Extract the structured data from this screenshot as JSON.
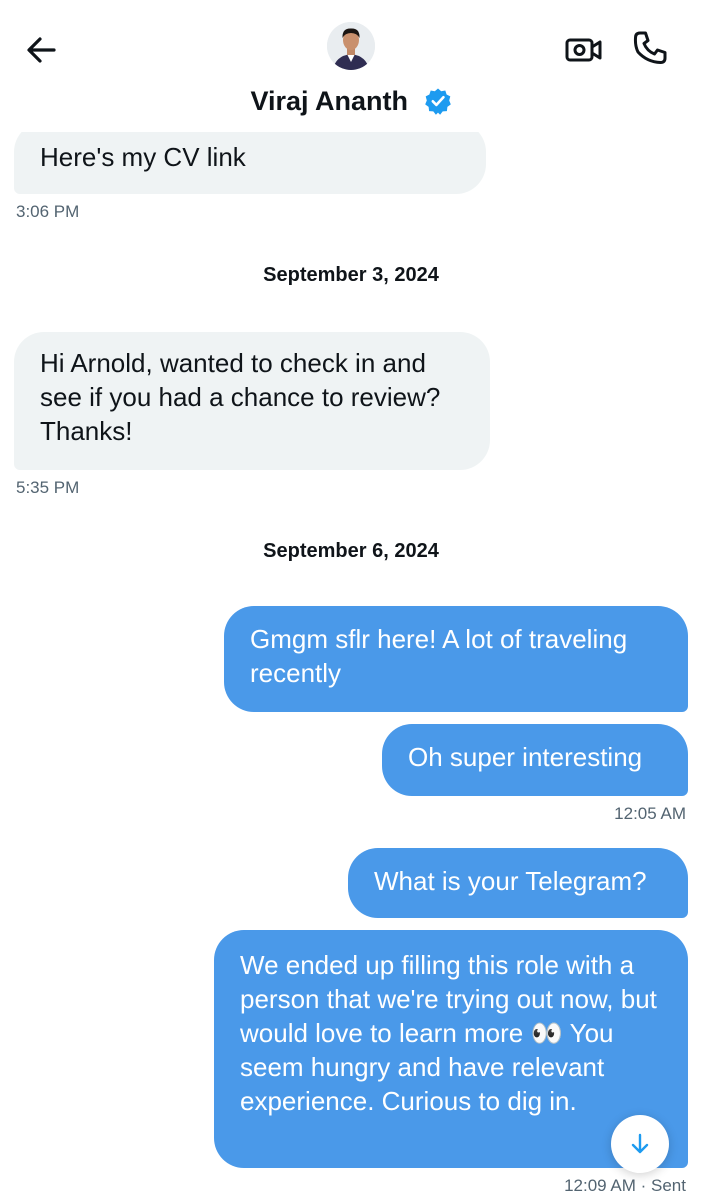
{
  "header": {
    "contact_name": "Viraj Ananth",
    "icons": {
      "back": "arrow-left-icon",
      "verified": "verified-badge-icon",
      "video": "video-call-icon",
      "phone": "phone-call-icon",
      "avatar": "avatar"
    }
  },
  "colors": {
    "outgoing_bubble": "#4a99e9",
    "incoming_bubble": "#eff3f4",
    "verified": "#1d9bf0",
    "timestamp": "#536471"
  },
  "messages": [
    {
      "text": "Here's my CV link",
      "time": "3:06 PM"
    },
    {
      "date_separator": "September 3, 2024"
    },
    {
      "text": "Hi Arnold, wanted to check in and see if you had a chance to review? Thanks!",
      "time": "5:35 PM"
    },
    {
      "date_separator": "September 6, 2024"
    },
    {
      "text": "Gmgm sflr here! A lot of traveling recently"
    },
    {
      "text": "Oh super interesting",
      "time": "12:05 AM"
    },
    {
      "text": "What is your Telegram?"
    },
    {
      "text": "We ended up filling this role with a person that we're trying out now, but would love to learn more 👀 You seem hungry and have relevant experience. Curious to dig in.",
      "time": "12:09 AM",
      "status": "Sent"
    }
  ],
  "scroll_button": {
    "icon": "arrow-down-icon"
  }
}
